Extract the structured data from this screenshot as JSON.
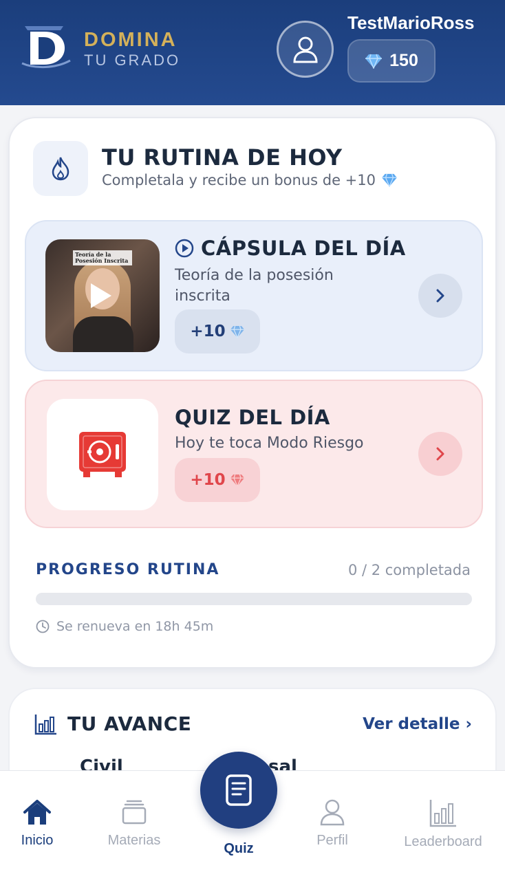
{
  "header": {
    "brand_top": "DOMINA",
    "brand_bottom": "TU GRADO",
    "username": "TestMarioRoss",
    "gems": "150"
  },
  "routine": {
    "title": "TU RUTINA DE HOY",
    "subtitle": "Completala y recibe un bonus de +10",
    "capsula": {
      "title": "CÁPSULA DEL DÍA",
      "description": "Teoría de la posesión inscrita",
      "reward": "+10",
      "thumbnail_caption": "Teoría de la Posesión Inscrita"
    },
    "quiz": {
      "title": "QUIZ DEL DÍA",
      "description": "Hoy te toca Modo Riesgo",
      "reward": "+10"
    },
    "progress": {
      "label": "PROGRESO RUTINA",
      "count": "0 / 2 completada",
      "fraction": 0
    },
    "renew": "Se renueva en 18h 45m"
  },
  "avance": {
    "title": "TU AVANCE",
    "detail_link": "Ver detalle ›",
    "peek_1": "Civil",
    "peek_2": "sal"
  },
  "nav": {
    "inicio": "Inicio",
    "materias": "Materias",
    "quiz": "Quiz",
    "perfil": "Perfil",
    "leaderboard": "Leaderboard"
  },
  "colors": {
    "brand_navy": "#1b3e7c",
    "gold": "#d4b15a",
    "capsula_bg": "#e9effa",
    "quiz_bg": "#fce9ea",
    "quiz_red": "#e0464b",
    "gem_blue": "#5aa8f0"
  }
}
